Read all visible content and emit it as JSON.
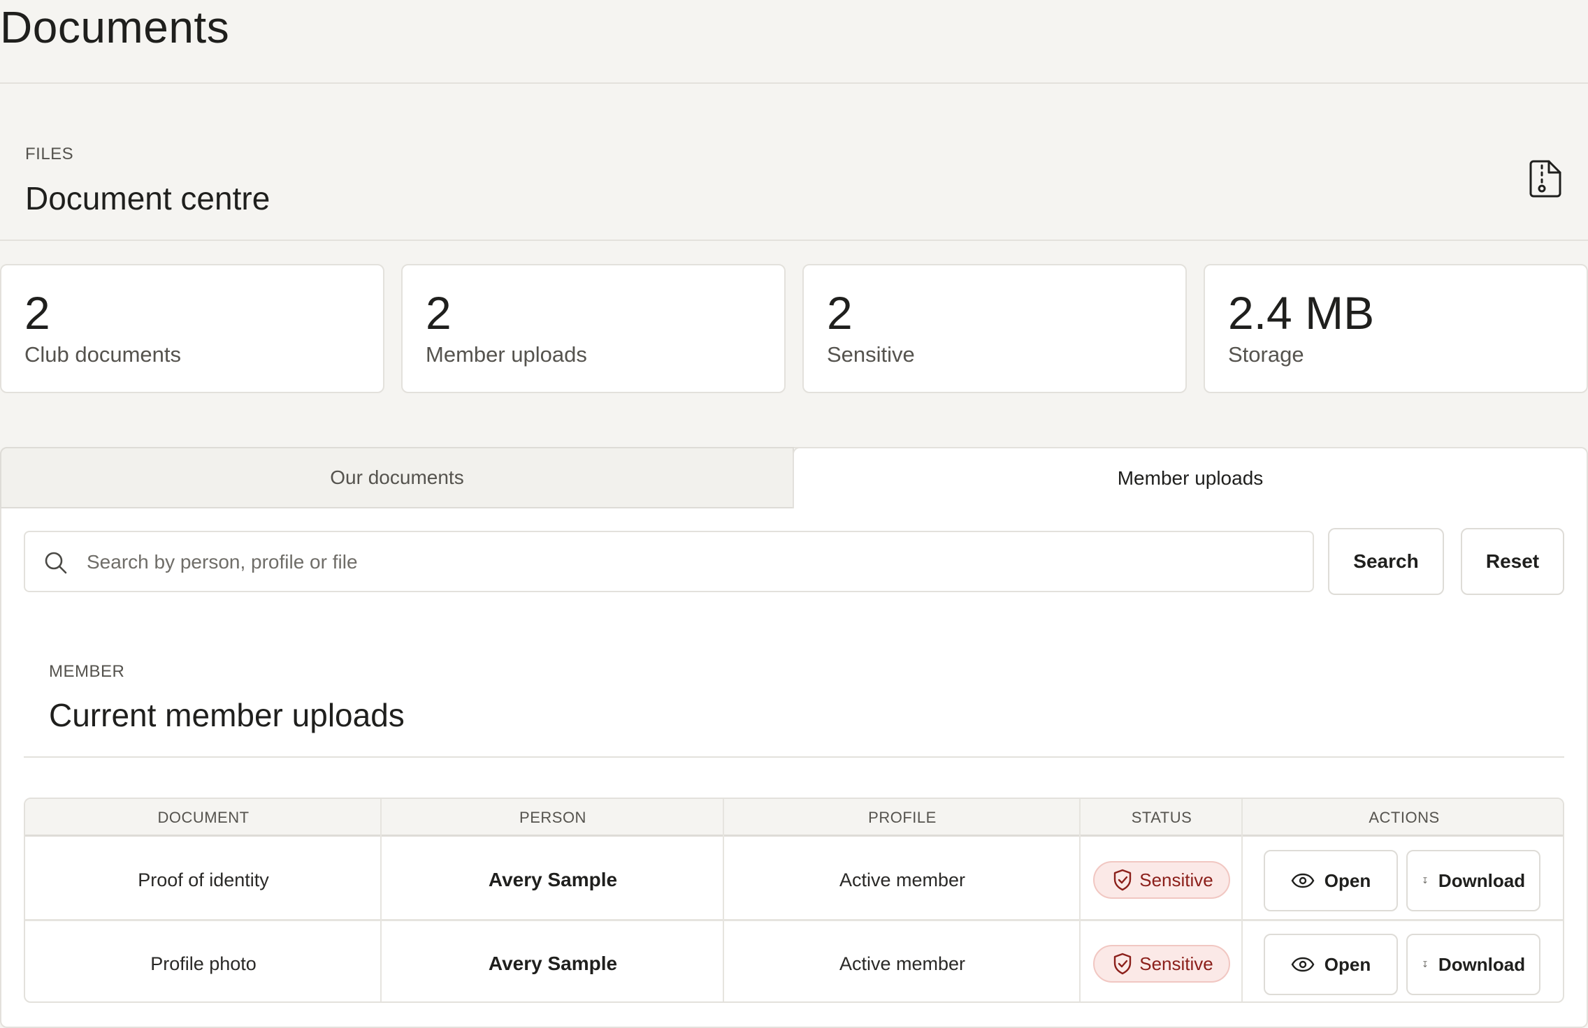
{
  "page": {
    "title": "Documents"
  },
  "hero": {
    "eyebrow": "FILES",
    "title": "Document centre",
    "icon": "file-zip-icon"
  },
  "stats": [
    {
      "value": "2",
      "label": "Club documents"
    },
    {
      "value": "2",
      "label": "Member uploads"
    },
    {
      "value": "2",
      "label": "Sensitive"
    },
    {
      "value": "2.4 MB",
      "label": "Storage"
    }
  ],
  "tabs": [
    {
      "label": "Our documents",
      "active": false
    },
    {
      "label": "Member uploads",
      "active": true
    }
  ],
  "search": {
    "placeholder": "Search by person, profile or file",
    "value": "",
    "search_label": "Search",
    "reset_label": "Reset",
    "icon": "search-icon"
  },
  "section": {
    "eyebrow": "MEMBER",
    "title": "Current member uploads"
  },
  "table": {
    "headers": [
      "DOCUMENT",
      "PERSON",
      "PROFILE",
      "STATUS",
      "ACTIONS"
    ],
    "rows": [
      {
        "document": "Proof of identity",
        "person": "Avery Sample",
        "profile": "Active member",
        "status": "Sensitive",
        "open_label": "Open",
        "download_label": "Download"
      },
      {
        "document": "Profile photo",
        "person": "Avery Sample",
        "profile": "Active member",
        "status": "Sensitive",
        "open_label": "Open",
        "download_label": "Download"
      }
    ]
  },
  "colors": {
    "background": "#f5f4f1",
    "card": "#ffffff",
    "border": "#e3e1dc",
    "badge_bg": "#fbe9e7",
    "badge_text": "#8b1f1a"
  }
}
